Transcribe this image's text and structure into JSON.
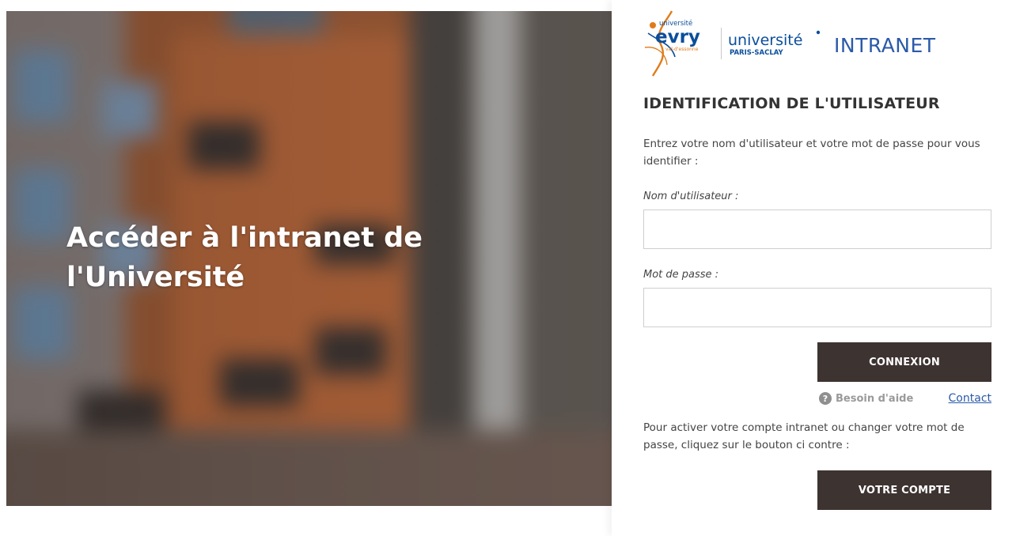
{
  "hero": {
    "title": "Accéder à l'intranet de l'Université"
  },
  "header": {
    "logo_evry_text": "evry",
    "logo_evry_top": "université",
    "logo_evry_bottom": "val-d'essonne",
    "logo_ups_top": "université",
    "logo_ups_bottom": "PARIS-SACLAY",
    "intranet_label": "INTRANET"
  },
  "login": {
    "section_title": "IDENTIFICATION DE L'UTILISATEUR",
    "instructions": "Entrez votre nom d'utilisateur et votre mot de passe pour vous identifier :",
    "username_label": "Nom d'utilisateur :",
    "username_value": "",
    "password_label": "Mot de passe :",
    "password_value": "",
    "submit_label": "CONNEXION",
    "help_label": "Besoin d'aide",
    "help_icon_glyph": "?",
    "contact_label": "Contact",
    "account_text": "Pour activer votre compte intranet ou changer votre mot de passe, cliquez sur le bouton ci contre :",
    "account_button_label": "VOTRE COMPTE"
  },
  "colors": {
    "accent_blue": "#2b5aa8",
    "button_dark": "#3d3331",
    "evry_orange": "#e07b1a",
    "evry_blue": "#0a4e9b"
  }
}
